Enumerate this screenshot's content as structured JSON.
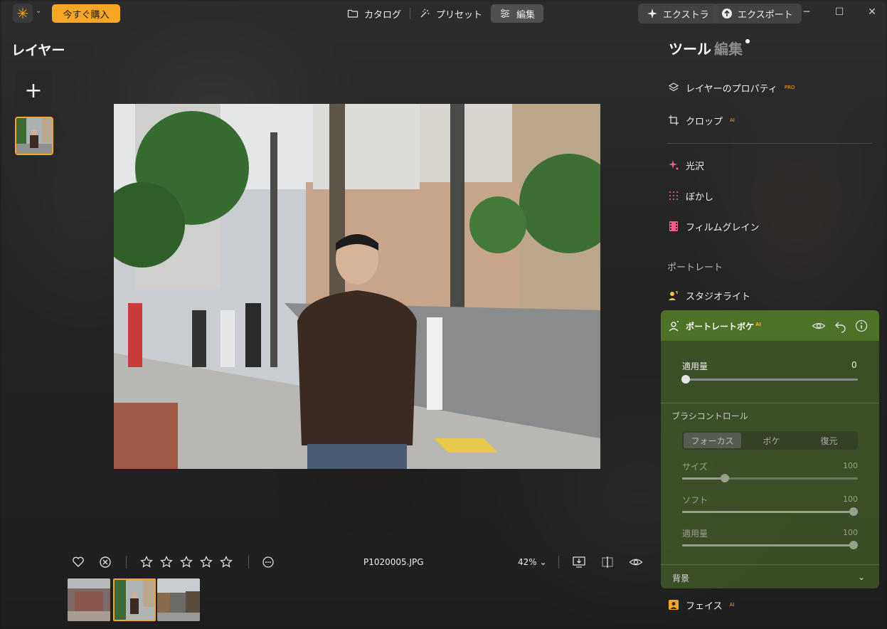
{
  "topbar": {
    "buy_label": "今すぐ購入",
    "tabs": [
      {
        "label": "カタログ",
        "icon": "folder-icon"
      },
      {
        "label": "プリセット",
        "icon": "sparkle-wand-icon"
      },
      {
        "label": "編集",
        "icon": "sliders-icon",
        "active": true
      }
    ],
    "extra_label": "エクストラ",
    "export_label": "エクスポート"
  },
  "left": {
    "title": "レイヤー",
    "add_symbol": "+"
  },
  "bottom": {
    "filename": "P1020005.JPG",
    "zoom": "42%",
    "rating_stars": 5,
    "rating_value": 0
  },
  "right": {
    "tab_tools": "ツール",
    "tab_edit": "編集",
    "tools": [
      {
        "label": "レイヤーのプロパティ",
        "badge": "PRO",
        "icon": "layers-icon"
      },
      {
        "label": "クロップ",
        "badge": "AI",
        "icon": "crop-icon"
      }
    ],
    "effects": [
      {
        "label": "光沢",
        "icon": "glow-sparkle-icon"
      },
      {
        "label": "ぼかし",
        "icon": "blur-dots-icon"
      },
      {
        "label": "フィルムグレイン",
        "icon": "film-icon"
      }
    ],
    "portrait_section": "ポートレート",
    "studio_light": "スタジオライト",
    "bokeh": {
      "title": "ポートレートボケ",
      "badge": "AI",
      "amount_label": "適用量",
      "amount_value": "0",
      "brush_title": "ブラシコントロール",
      "segments": [
        "フォーカス",
        "ボケ",
        "復元"
      ],
      "size_label": "サイズ",
      "size_value": "100",
      "soft_label": "ソフト",
      "soft_value": "100",
      "apply_label": "適用量",
      "apply_value": "100",
      "background_label": "背景"
    },
    "face_label": "フェイス",
    "face_badge": "AI"
  },
  "colors": {
    "accent": "#f5a623",
    "bokeh_header": "#5a7a2a"
  }
}
